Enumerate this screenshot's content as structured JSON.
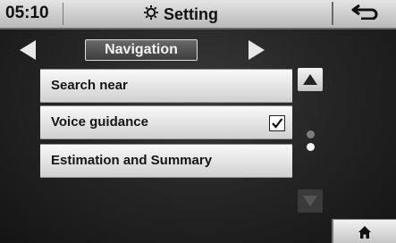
{
  "status_bar": {
    "time": "05:10",
    "title": "Setting",
    "title_icon": "gear-icon",
    "back_icon": "return-arrow-icon"
  },
  "navigation": {
    "category_label": "Navigation",
    "prev_icon": "triangle-left-icon",
    "next_icon": "triangle-right-icon"
  },
  "menu": {
    "items": [
      {
        "label": "Search near",
        "has_checkbox": false
      },
      {
        "label": "Voice guidance",
        "has_checkbox": true,
        "checked": true
      },
      {
        "label": "Estimation and Summary",
        "has_checkbox": false
      }
    ]
  },
  "scroll": {
    "up_icon": "triangle-up-icon",
    "down_icon": "triangle-down-icon",
    "page_count": 2,
    "current_page": 2,
    "down_enabled": false
  },
  "home_icon": "home-icon",
  "colors": {
    "top_bar": "#d0d0d0",
    "menu_item": "#e6e6e6",
    "background": "#2a2a2a",
    "category_button": "#555555"
  }
}
